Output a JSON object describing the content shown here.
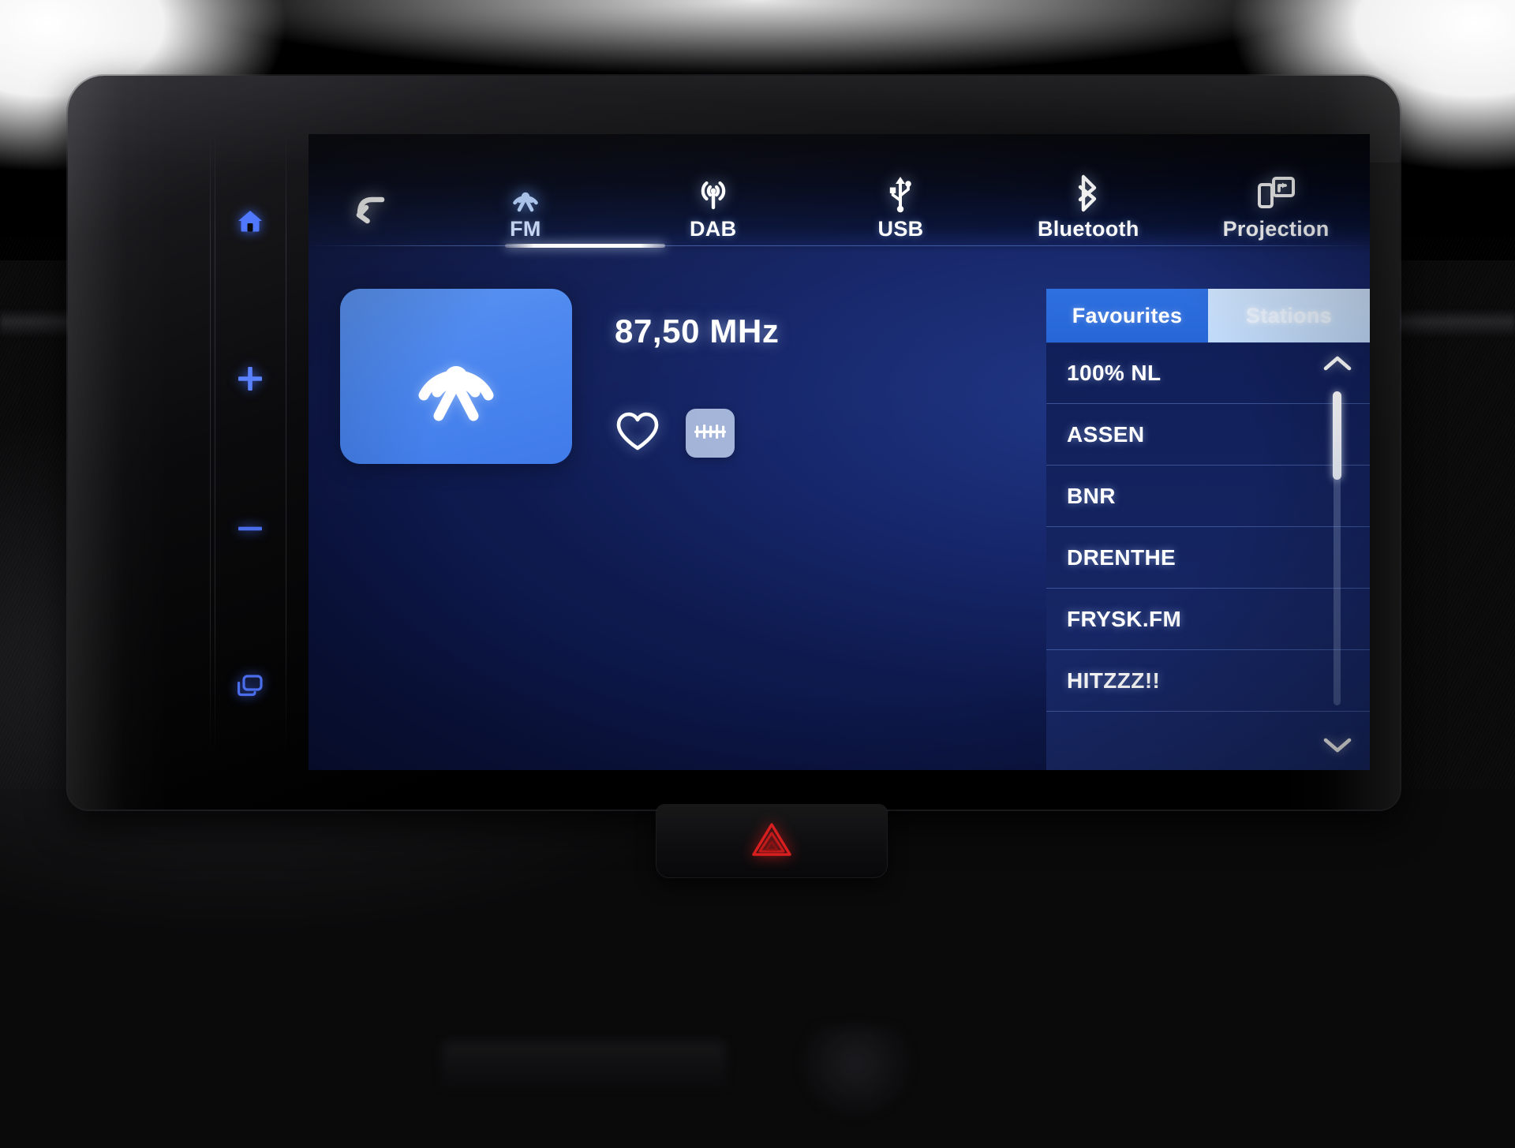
{
  "hardware_buttons": [
    {
      "name": "home",
      "icon": "home-icon"
    },
    {
      "name": "volume-up",
      "icon": "plus-icon"
    },
    {
      "name": "volume-down",
      "icon": "minus-icon"
    },
    {
      "name": "apps",
      "icon": "windows-apps-icon"
    }
  ],
  "nav": {
    "back_icon": "back-arrow-icon",
    "items": [
      {
        "label": "FM",
        "icon": "broadcast-tower-icon",
        "active": true
      },
      {
        "label": "DAB",
        "icon": "antenna-waves-icon",
        "active": false
      },
      {
        "label": "USB",
        "icon": "usb-icon",
        "active": false
      },
      {
        "label": "Bluetooth",
        "icon": "bluetooth-icon",
        "active": false
      },
      {
        "label": "Projection",
        "icon": "screen-mirroring-icon",
        "active": false
      }
    ]
  },
  "now_playing": {
    "artwork_icon": "broadcast-tower-icon",
    "frequency": "87,50 MHz",
    "favourite_icon": "heart-outline-icon",
    "tuning_icon": "frequency-scale-icon"
  },
  "list_panel": {
    "tabs": [
      {
        "label": "Favourites",
        "active": false
      },
      {
        "label": "Stations",
        "active": true
      }
    ],
    "stations": [
      {
        "name": "100% NL"
      },
      {
        "name": "ASSEN"
      },
      {
        "name": "BNR"
      },
      {
        "name": "DRENTHE"
      },
      {
        "name": "FRYSK.FM"
      },
      {
        "name": "HITZZZ!!"
      }
    ],
    "scroll": {
      "up_icon": "chevron-up-icon",
      "down_icon": "chevron-down-icon"
    }
  },
  "hazard": {
    "icon": "hazard-triangle-icon"
  },
  "colors": {
    "accent_blue": "#4a86ef",
    "tab_active": "#cde2fb",
    "tab_inactive": "#2d6fe0",
    "screen_bg": "#0e1a4e",
    "text": "#ffffff",
    "hazard_red": "#d81f1f",
    "button_glow": "#4a6eff"
  }
}
